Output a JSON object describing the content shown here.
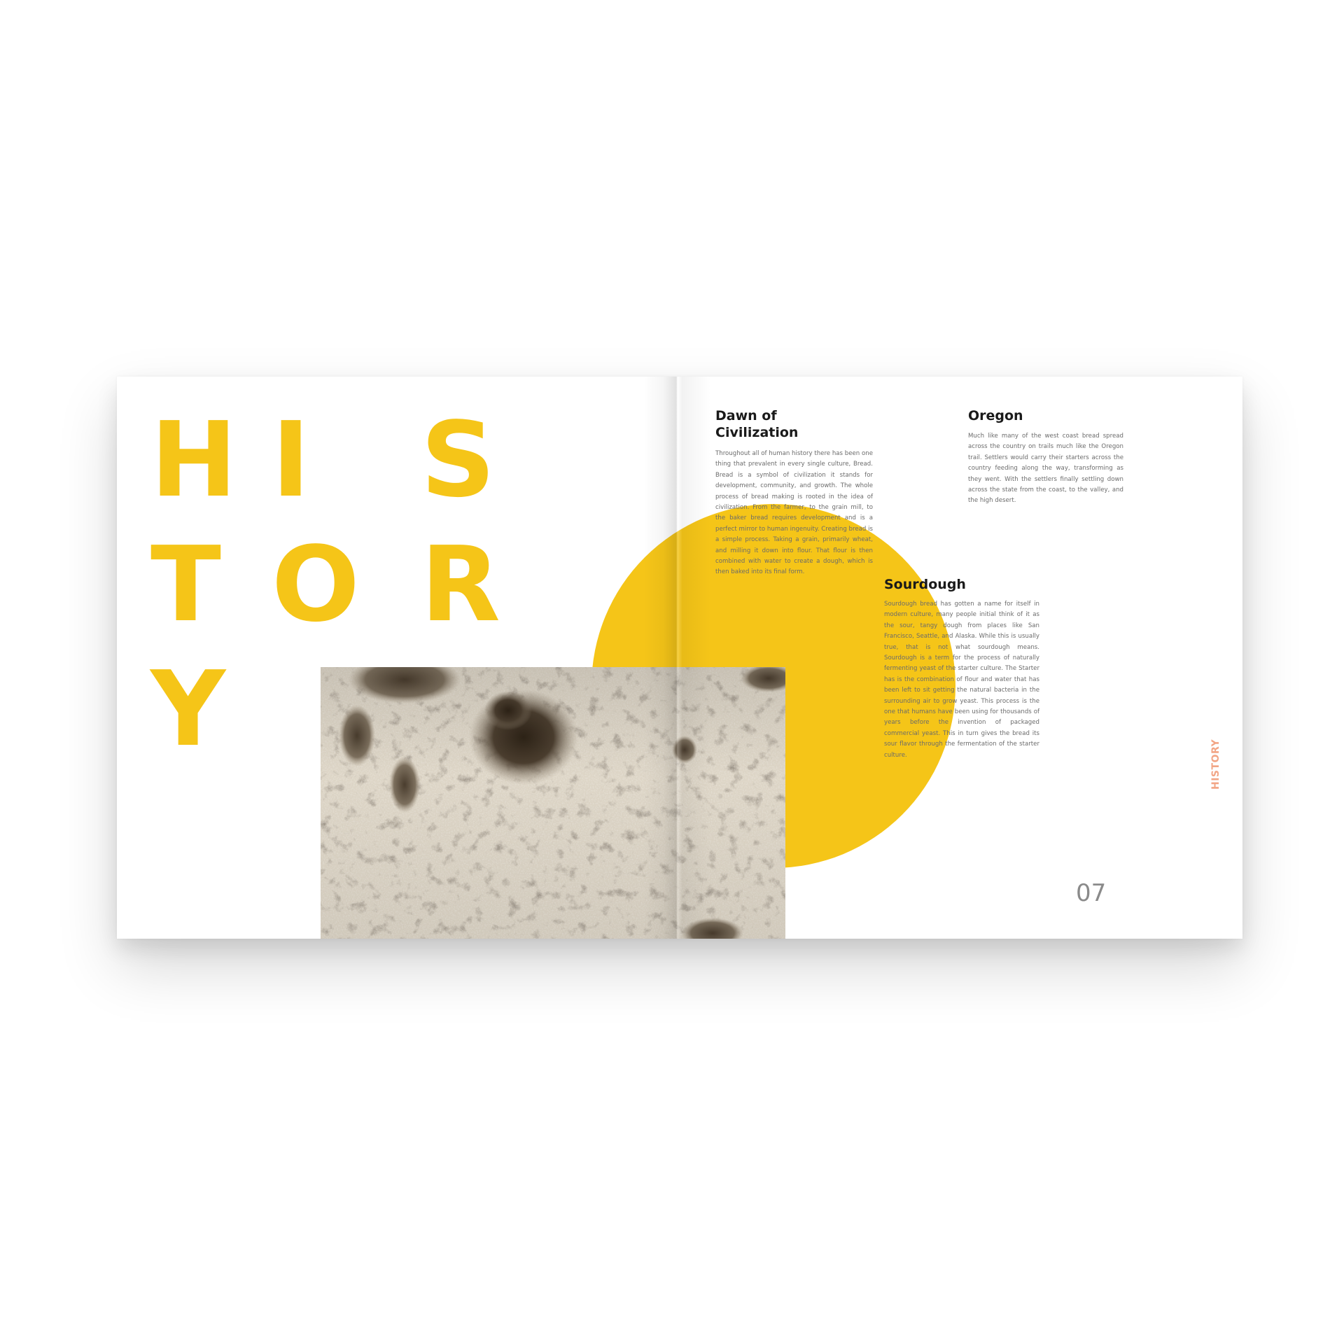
{
  "left_page": {
    "title_letters": [
      "H",
      "I",
      "S",
      "T",
      "O",
      "R",
      "Y"
    ]
  },
  "right_page": {
    "running_head": "HISTORY",
    "page_number": "07",
    "sections": [
      {
        "heading": "Dawn of Civilization",
        "body": "Throughout all of human history there has been one thing that prevalent in every single culture, Bread. Bread is a symbol of civilization it stands for development, community, and growth. The whole process of bread making is rooted in the idea of civilization. From the farmer, to the grain mill, to the baker bread requires development and is a perfect mirror to human ingenuity. Creating bread is a simple process. Taking a grain, primarily wheat, and milling it down into flour. That flour is then combined with water to create a dough, which is then baked into its final form."
      },
      {
        "heading": "Oregon",
        "body": "Much like many of the west coast bread spread across the country on trails much like the Oregon trail. Settlers would carry their starters across the country feeding along the way, transforming as they went. With the settlers finally settling down across the state from the coast, to the valley, and the high desert."
      },
      {
        "heading": "Sourdough",
        "body": "Sourdough bread has gotten a name for itself in modern culture, many people initial think of it as the sour, tangy dough from places like San Francisco, Seattle, and Alaska. While this is usually true, that is not what sourdough means. Sourdough is a term for the process of naturally fermenting yeast of the starter culture. The Starter has is the combination of flour and water that has been left to sit getting the natural bacteria in the surrounding air to grow yeast. This process is the one that humans have been using for thousands of years before the invention of packaged commercial yeast. This in turn gives the bread its sour flavor through the fermentation of the starter culture."
      }
    ]
  },
  "colors": {
    "accent_yellow": "#f5c518",
    "running_head_salmon": "#f2a585",
    "heading_text": "#1a1a1a",
    "body_text": "#6b6b6b",
    "page_number": "#8a8a8a"
  },
  "image": {
    "subject": "bread-crumb-texture-photo"
  }
}
